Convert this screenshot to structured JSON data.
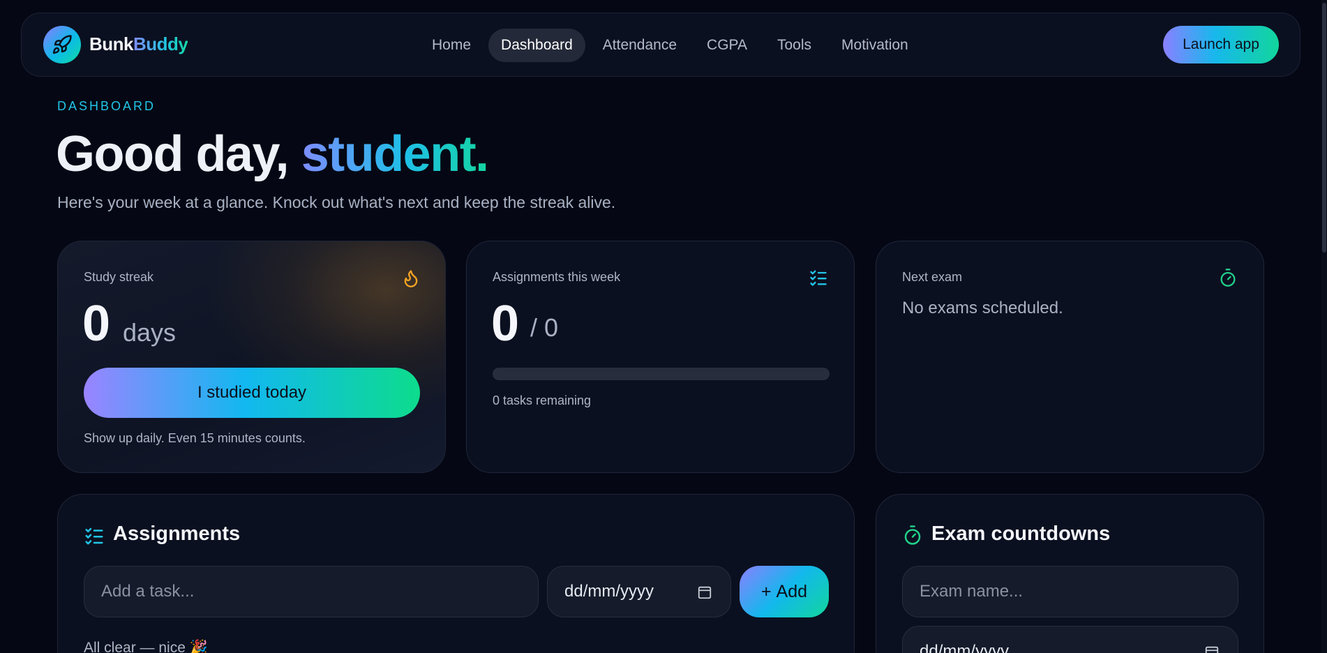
{
  "nav": {
    "brand_a": "Bunk",
    "brand_b": "Buddy",
    "logo_icon": "rocket-icon",
    "links": [
      {
        "label": "Home",
        "active": false
      },
      {
        "label": "Dashboard",
        "active": true
      },
      {
        "label": "Attendance",
        "active": false
      },
      {
        "label": "CGPA",
        "active": false
      },
      {
        "label": "Tools",
        "active": false
      },
      {
        "label": "Motivation",
        "active": false
      }
    ],
    "launch_label": "Launch app"
  },
  "hero": {
    "eyebrow": "DASHBOARD",
    "greeting": "Good day, ",
    "name": "student.",
    "subtitle": "Here's your week at a glance. Knock out what's next and keep the streak alive."
  },
  "streak": {
    "label": "Study streak",
    "icon": "flame-icon",
    "count": "0",
    "unit": "days",
    "button_label": "I studied today",
    "hint": "Show up daily. Even 15 minutes counts."
  },
  "assignments_summary": {
    "label": "Assignments this week",
    "icon": "checklist-icon",
    "done": "0",
    "total": "/ 0",
    "progress": 0,
    "remaining": "0 tasks remaining"
  },
  "next_exam": {
    "label": "Next exam",
    "icon": "stopwatch-icon",
    "empty": "No exams scheduled."
  },
  "tasks": {
    "title": "Assignments",
    "task_placeholder": "Add a task...",
    "date_value": "dd/mm/yyyy",
    "add_label": "Add",
    "empty_note": "All clear — nice 🎉"
  },
  "exams": {
    "title": "Exam countdowns",
    "name_placeholder": "Exam name...",
    "date_value": "dd/mm/yyyy"
  },
  "colors": {
    "background": "#050814",
    "accent_purple": "#8a80ff",
    "accent_cyan": "#12b8ec",
    "accent_green": "#12d69c",
    "flame": "#f5a524"
  }
}
